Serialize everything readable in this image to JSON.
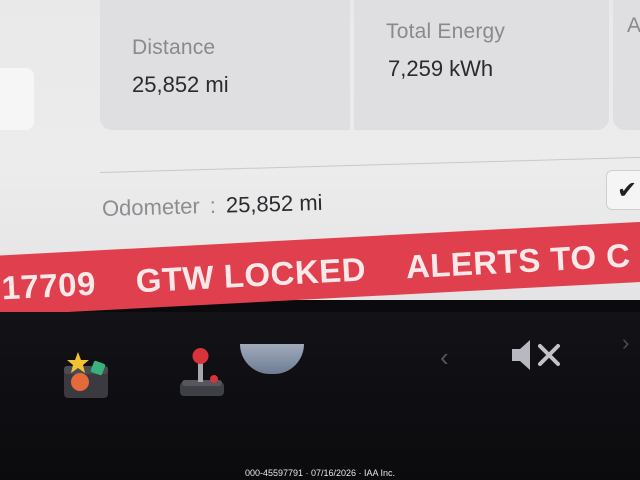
{
  "cards": {
    "distance": {
      "label": "Distance",
      "value": "25,852 mi"
    },
    "energy": {
      "label": "Total Energy",
      "value": "7,259 kWh"
    },
    "extra": {
      "label": "A"
    }
  },
  "odometer": {
    "label": "Odometer",
    "separator": ":",
    "value": "25,852 mi"
  },
  "banner": {
    "items": [
      "17709",
      "GTW LOCKED",
      "ALERTS TO C"
    ],
    "color": "#e0404e"
  },
  "dock": {
    "icons": [
      "toybox-icon",
      "joystick-icon",
      "chevron-left-icon",
      "mute-icon",
      "chevron-right-icon"
    ],
    "chevron_left": "‹",
    "chevron_right": "›"
  },
  "checkbox": {
    "checked": true
  },
  "footer": {
    "text": "000-45597791 · 07/16/2026 · IAA Inc."
  }
}
